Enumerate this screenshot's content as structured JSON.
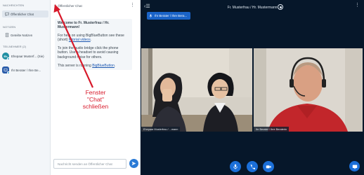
{
  "sidebar": {
    "messages_title": "NACHRICHTEN",
    "public_chat_label": "Öffentlicher Chat",
    "notes_title": "NOTIZEN",
    "shared_notes_label": "Geteilte Notizen",
    "participants_title": "TEILNEHMER (2)",
    "users": [
      {
        "initials": "Eh",
        "name": "Ehepaar Musterf... (Sie)",
        "color": "#1f8fa3"
      },
      {
        "initials": "",
        "name": "Ihr Berater / Ihre Be...",
        "color": "#2a5caa"
      }
    ]
  },
  "chat": {
    "title": "Öffentlicher Chat",
    "welcome_line": "Welcome to Fr. Musterfrau / Hr. Mustermann!",
    "help_pre": "For help on using BigBlueButton see these (short) ",
    "help_link": "tutorial videos",
    "help_post": ".",
    "audio_text": "To join the audio bridge click the phone button. Use a headset to avoid causing background noise for others.",
    "server_pre": "This server is running ",
    "server_link": "BigBlueButton",
    "server_post": ".",
    "input_placeholder": "Nachricht senden an Öffentlicher Chat"
  },
  "annotation": {
    "line1": "Fenster",
    "line2": "\"Chat\"",
    "line3": "schließen",
    "color": "#d7192a"
  },
  "main": {
    "meeting_title": "Fr. Musterfrau / Hr. Mustermann",
    "talker_label": "Ihr Berater / Ihre Bera...",
    "video1_label": "Ehepaar Musterfrau / ...mann",
    "video2_label": "Ihr Berater / Ihre Beraterin",
    "accent": "#1b6fd8",
    "background": "#06172a"
  }
}
